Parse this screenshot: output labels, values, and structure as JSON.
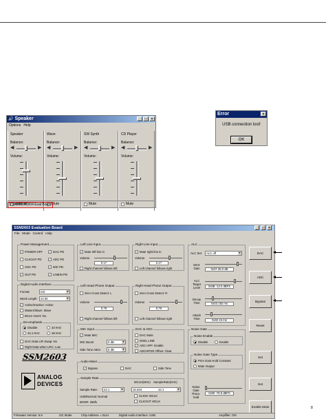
{
  "speaker_window": {
    "title": "Speaker",
    "menu": [
      "Options",
      "Help"
    ],
    "columns": [
      {
        "title": "Speaker",
        "balance_label": "Balance:",
        "volume_label": "Volume:",
        "mute_label": "Mute all",
        "volume_level": 0.75
      },
      {
        "title": "Wave",
        "balance_label": "Balance:",
        "volume_label": "Volume:",
        "mute_label": "Mute",
        "volume_level": 0.5
      },
      {
        "title": "SW Synth",
        "balance_label": "Balance:",
        "volume_label": "Volume:",
        "mute_label": "Mute",
        "volume_level": 0.5
      },
      {
        "title": "CD Player",
        "balance_label": "Balance:",
        "volume_label": "Volume:",
        "mute_label": "Mute",
        "volume_level": 0.5
      }
    ],
    "status": "SSM2602/03/04 Eval Board"
  },
  "error_dialog": {
    "title": "Error",
    "message": "USB connection lost!",
    "ok_label": "OK"
  },
  "eval_board": {
    "title": "SSM2603 Evaluation Board",
    "menu": [
      "File",
      "Mode",
      "Control",
      "Help"
    ],
    "power_management": {
      "title": "Power Management",
      "items": [
        {
          "label": "POWER OFF",
          "checked": true
        },
        {
          "label": "DAC PD",
          "checked": true
        },
        {
          "label": "CLKOUT PD",
          "checked": false
        },
        {
          "label": "ADC PD",
          "checked": true
        },
        {
          "label": "OSC PD",
          "checked": false
        },
        {
          "label": "MIC PD",
          "checked": true
        },
        {
          "label": "OUT PD",
          "checked": true
        },
        {
          "label": "LINEIN PD",
          "checked": true
        }
      ]
    },
    "digital_audio": {
      "title": "Digital Audio Interface",
      "format_label": "Format",
      "format_value": "I2S",
      "wordlength_label": "Word Length",
      "wordlength_value": "24 bit",
      "checks": [
        {
          "label": "Active/Inactive: Active",
          "checked": true
        },
        {
          "label": "Master/Slave: Slave",
          "checked": false
        },
        {
          "label": "BCLK Invert: No",
          "checked": false
        }
      ],
      "deemph_title": "De-emphasis",
      "deemph": [
        {
          "label": "Disable",
          "selected": true
        },
        {
          "label": "32 KHz",
          "selected": false
        },
        {
          "label": "44.1 KHz",
          "selected": false
        },
        {
          "label": "48 KHz",
          "selected": false
        }
      ],
      "bottom_checks": [
        {
          "label": "DAC Data L/R Swap: No",
          "checked": false
        },
        {
          "label": "Right Data when LRC: Low",
          "checked": false
        }
      ]
    },
    "left_line": {
      "title": "Left Line Input",
      "mute_label": "Mute left line in",
      "volume_label": "Volume",
      "volume_value": "0.17",
      "follow_label": "Right channel follows left"
    },
    "right_line": {
      "title": "Right Line Input",
      "mute_label": "Mute right line in",
      "volume_label": "Volume",
      "volume_value": "0.17",
      "follow_label": "Left channel follows right"
    },
    "left_hp": {
      "title": "Left Head Phone Output",
      "zc_label": "Zero Cross Detect: L",
      "volume_label": "Volume",
      "volume_value": "0.79",
      "follow_label": "Right channel follows left"
    },
    "right_hp": {
      "title": "Right Head Phone Output",
      "zc_label": "Zero Cross Detect: R",
      "volume_label": "Volume",
      "volume_value": "0.79",
      "follow_label": "Left channel follows right"
    },
    "mic_input": {
      "title": "MIC Input",
      "mute_label": "Mute MIC",
      "boost_label": "MIC Boost",
      "boost_value": "0 dB",
      "sidetone_label": "Side Tone Atten",
      "sidetone_value": "6 dB"
    },
    "dac_adc": {
      "title": "DAC & ADC",
      "items": [
        {
          "label": "DAC Mute",
          "checked": false
        },
        {
          "label": "NSEL LINE",
          "checked": false
        },
        {
          "label": "ADC HPF: Enable",
          "checked": true
        },
        {
          "label": "ADCHPOR Offset: Clear",
          "checked": false
        }
      ]
    },
    "audio_mixer": {
      "title": "Audio Mixer",
      "items": [
        {
          "label": "Bypass",
          "checked": true
        },
        {
          "label": "DAC",
          "checked": false
        },
        {
          "label": "Side Tone",
          "checked": false
        }
      ]
    },
    "sample_rate": {
      "title": "Sample Rate",
      "rate_label": "Sample Rate:",
      "rate_value": "44.1",
      "usb_label": "USB/Normal: Normal",
      "bosr_label": "BOSR: 256fs",
      "mclk_header": "MCLK(MHz)",
      "srate_header": "SampleRate(KHz)",
      "mclk_value": "16.934",
      "srate_value": "44.1",
      "clkin_label": "CLKIN: MCLK",
      "clkout_label": "CLKOUT: MCLK"
    },
    "alc": {
      "title": "ALC",
      "set_label": "ALC Set",
      "set_value": "ALC off",
      "max_gain_label": "MAX Gain",
      "max_gain_value": "0x07   36.0 dB",
      "target_label": "ALC Target Level",
      "target_value": "0x0B   -12.0 dBFS",
      "decay_label": "Decay Time",
      "decay_value": "0x03   192 ms",
      "attack_label": "Attack Time",
      "attack_value": "0x02   24 ms"
    },
    "noise_gate": {
      "title": "Noise Gate",
      "enable_title": "Noise Enable",
      "disable_label": "Disable",
      "enable_label": "Enable",
      "type_title": "Noise Gate Type",
      "type_hold": "PGA Gain Hold Constant",
      "type_mute": "Mute Output",
      "thresh_label": "Noise Gate Thres-hold",
      "thresh_value": "0x00   -76.5 dBFS"
    },
    "buttons": [
      "DAC",
      "ADC",
      "Bypass",
      "Reset",
      "Set",
      "Get",
      "Enable Mute"
    ],
    "logo_top": "SSM2603",
    "logo_brand_1": "ANALOG",
    "logo_brand_2": "DEVICES",
    "status": {
      "firmware": "Firmware Version: 6.5",
      "mode": "I2C Mode",
      "chip": "Chip Address = 0x1A",
      "interface": "Digital Audio Interface: USB",
      "amplifier": "Amplifier: ON"
    }
  },
  "page_corner": "8"
}
